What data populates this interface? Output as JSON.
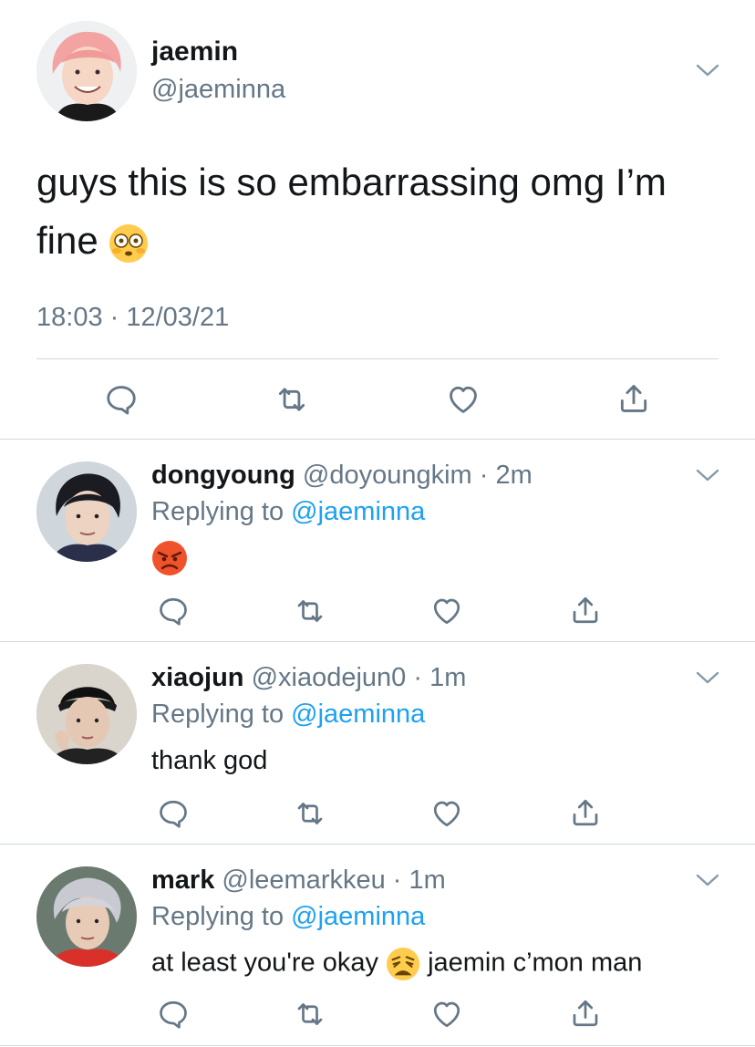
{
  "main": {
    "name": "jaemin",
    "handle": "@jaeminna",
    "text": "guys this is so embarrassing omg I’m fine",
    "text_line1": "guys this is so embarrassing omg I’m",
    "text_line2": "fine",
    "emoji": "flushed-face",
    "timestamp": "18:03 · 12/03/21"
  },
  "replies": [
    {
      "name": "dongyoung",
      "handle": "@doyoungkim",
      "time": "· 2m",
      "replying_prefix": "Replying to",
      "replying_to": "@jaeminna",
      "text": "",
      "emoji": "angry-face"
    },
    {
      "name": "xiaojun",
      "handle": "@xiaodejun0",
      "time": "· 1m",
      "replying_prefix": "Replying to",
      "replying_to": "@jaeminna",
      "text": "thank god"
    },
    {
      "name": "mark",
      "handle": "@leemarkkeu",
      "time": "· 1m",
      "replying_prefix": "Replying to",
      "replying_to": "@jaeminna",
      "text_before": "at least you're okay",
      "emoji": "weary-face",
      "text_after": "jaemin c’mon man"
    }
  ],
  "icons": {
    "reply": "reply-icon",
    "retweet": "retweet-icon",
    "like": "heart-icon",
    "share": "share-icon",
    "menu": "chevron-down-icon"
  },
  "colors": {
    "text": "#14171a",
    "muted": "#657786",
    "link": "#1da1f2",
    "divider": "#cfd8de"
  }
}
